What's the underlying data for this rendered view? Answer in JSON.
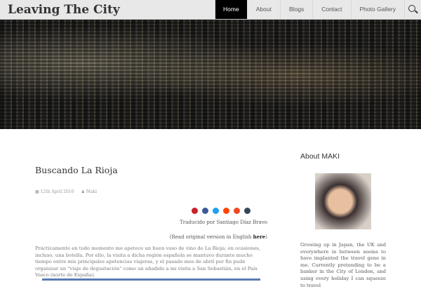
{
  "site": {
    "title": "Leaving The City"
  },
  "nav": {
    "items": [
      {
        "label": "Home"
      },
      {
        "label": "About"
      },
      {
        "label": "Blogs"
      },
      {
        "label": "Contact"
      },
      {
        "label": "Photo Gallery"
      }
    ]
  },
  "post": {
    "title": "Buscando La Rioja",
    "date": "12th April 2016",
    "author": "Maki",
    "share_icons": [
      "pinterest-icon",
      "facebook-icon",
      "twitter-icon",
      "reddit-icon",
      "stumbleupon-icon",
      "tumblr-icon"
    ],
    "translated": "Traducido por Santiago Díaz Bravo",
    "original_prefix": "(Read original version in English ",
    "original_link": "here",
    "original_suffix": ")",
    "body": "Prácticamente en todo momento me apetece un buen vaso de vino de La Rioja; en ocasiones, incluso, una botella. Por ello, la visita a dicha región española se mantuvo durante mucho tiempo entre mis principales apetencias viajeras, y el pasado mes de abril por fin pude organizar un \"viaje de degustación\" como un añadido a mi visita a San Sebastián, en el País Vasco (norte de España)."
  },
  "sidebar": {
    "heading": "About MAKI",
    "bio": "Growing up in Japan, the UK and everywhere in between seems to have implanted the travel gene in me. Currently pretending to be a banker in the City of London, and using every holiday I can squeeze to travel"
  }
}
